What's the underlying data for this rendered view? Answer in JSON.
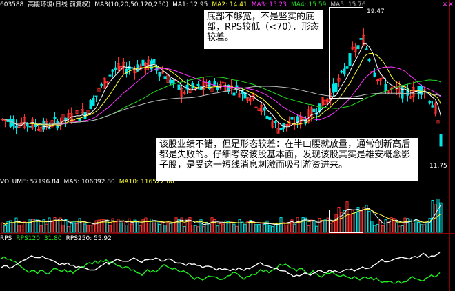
{
  "colors": {
    "up": "#ff3030",
    "down": "#00e5e5",
    "ma1": "#ffffff",
    "ma2": "#ffff33",
    "ma3": "#ff33ff",
    "ma4": "#22dd22",
    "ma5": "#bbbbbb",
    "rps120": "#22ee22",
    "rps250": "#ffffff",
    "annot_border": "#000000"
  },
  "price_header": {
    "code": "603588",
    "name": "高能环境(日线 前复权)",
    "ma_params": "MA3(10,20,50,120,250)",
    "ma1": "MA1: 12.95",
    "ma2": "MA2: 14.41",
    "ma3": "MA3: 15.23",
    "ma4": "MA4: 15.59",
    "ma5": "MA5: 15.76"
  },
  "corner_icon": "close-marker-icon",
  "corner_text": "××",
  "volume_header": {
    "label": "VOLUME: 57196.84",
    "ma5": "MA5: 106092.80",
    "ma10": "MA10: 116522.00"
  },
  "rps_header": {
    "label": "RPS",
    "rps120": "RPS120: 31.80",
    "rps250": "RPS250: 55.92"
  },
  "annotations": {
    "top": "底部不够宽，不是坚实的底部，RPS较低（<70），形态较差。",
    "middle": "该股业绩不错，但是形态较差：在半山腰就放量，通常创新高后都是失败的。仔细考察该股基本面，发现该股其实是雄安概念影子股，是受这一短线消息刺激而吸引游资进来。"
  },
  "price_labels": {
    "high": "19.47",
    "low": "11.75"
  },
  "chart_data": [
    {
      "type": "candlestick",
      "title": "603588 高能环境(日线 前复权)",
      "ylim": [
        10.5,
        20.5
      ],
      "high_label": 19.47,
      "low_label": 11.75,
      "series": [
        "MA1",
        "MA2",
        "MA3",
        "MA4",
        "MA5"
      ],
      "values": [
        12.95,
        14.41,
        15.23,
        15.59,
        15.76
      ]
    },
    {
      "type": "bar",
      "title": "VOLUME",
      "series": [
        "VOLUME",
        "MA5",
        "MA10"
      ],
      "values": [
        57196.84,
        106092.8,
        116522.0
      ]
    },
    {
      "type": "line",
      "title": "RPS",
      "series": [
        {
          "name": "RPS120",
          "values": [
            31.8
          ]
        },
        {
          "name": "RPS250",
          "values": [
            55.92
          ]
        }
      ]
    }
  ]
}
